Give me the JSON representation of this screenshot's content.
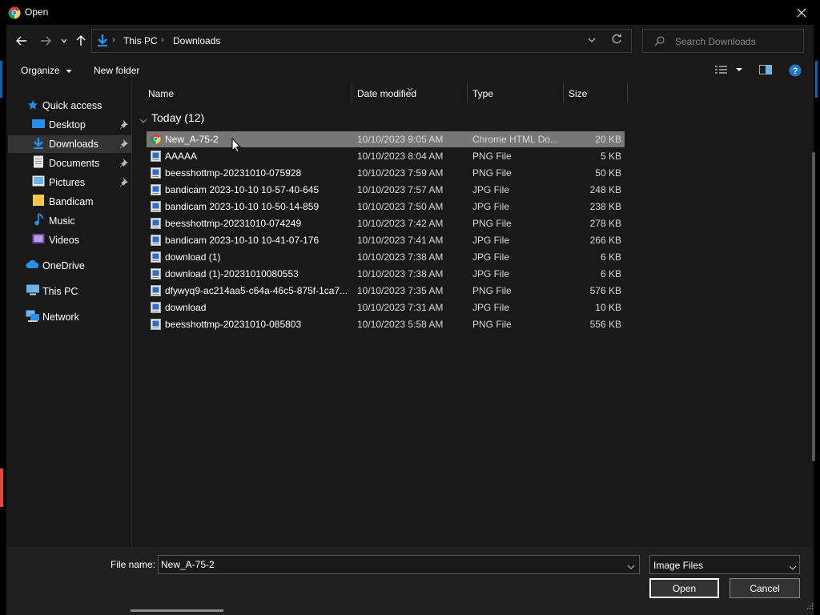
{
  "window": {
    "title": "Open"
  },
  "address": {
    "crumbs": [
      "This PC",
      "Downloads"
    ]
  },
  "search": {
    "placeholder": "Search Downloads"
  },
  "toolbar": {
    "organize_label": "Organize",
    "new_folder_label": "New folder"
  },
  "nav": {
    "items": [
      {
        "label": "Quick access",
        "icon": "star-icon"
      },
      {
        "label": "Desktop",
        "icon": "desktop-icon",
        "pinned": true
      },
      {
        "label": "Downloads",
        "icon": "download-arrow-icon",
        "pinned": true,
        "selected": true
      },
      {
        "label": "Documents",
        "icon": "document-icon",
        "pinned": true
      },
      {
        "label": "Pictures",
        "icon": "pictures-icon",
        "pinned": true
      },
      {
        "label": "Bandicam",
        "icon": "folder-icon"
      },
      {
        "label": "Music",
        "icon": "music-note-icon"
      },
      {
        "label": "Videos",
        "icon": "video-icon"
      },
      {
        "label": "OneDrive",
        "icon": "cloud-icon"
      },
      {
        "label": "This PC",
        "icon": "computer-icon"
      },
      {
        "label": "Network",
        "icon": "network-icon"
      }
    ]
  },
  "columns": {
    "name": "Name",
    "date": "Date modified",
    "type": "Type",
    "size": "Size"
  },
  "group": {
    "label": "Today (12)"
  },
  "files": [
    {
      "name": "New_A-75-2",
      "date": "10/10/2023 9:05 AM",
      "type": "Chrome HTML Do...",
      "size": "20 KB",
      "icon": "chrome-icon",
      "selected": true
    },
    {
      "name": "AAAAA",
      "date": "10/10/2023 8:04 AM",
      "type": "PNG File",
      "size": "5 KB",
      "icon": "image-file-icon"
    },
    {
      "name": "beesshottmp-20231010-075928",
      "date": "10/10/2023 7:59 AM",
      "type": "PNG File",
      "size": "50 KB",
      "icon": "image-file-icon"
    },
    {
      "name": "bandicam 2023-10-10 10-57-40-645",
      "date": "10/10/2023 7:57 AM",
      "type": "JPG File",
      "size": "248 KB",
      "icon": "image-file-icon"
    },
    {
      "name": "bandicam 2023-10-10 10-50-14-859",
      "date": "10/10/2023 7:50 AM",
      "type": "JPG File",
      "size": "238 KB",
      "icon": "image-file-icon"
    },
    {
      "name": "beesshottmp-20231010-074249",
      "date": "10/10/2023 7:42 AM",
      "type": "PNG File",
      "size": "278 KB",
      "icon": "image-file-icon"
    },
    {
      "name": "bandicam 2023-10-10 10-41-07-176",
      "date": "10/10/2023 7:41 AM",
      "type": "JPG File",
      "size": "266 KB",
      "icon": "image-file-icon"
    },
    {
      "name": "download (1)",
      "date": "10/10/2023 7:38 AM",
      "type": "JPG File",
      "size": "6 KB",
      "icon": "image-file-icon"
    },
    {
      "name": "download (1)-20231010080553",
      "date": "10/10/2023 7:38 AM",
      "type": "JPG File",
      "size": "6 KB",
      "icon": "image-file-icon"
    },
    {
      "name": "dfywyq9-ac214aa5-c64a-46c5-875f-1ca7...",
      "date": "10/10/2023 7:35 AM",
      "type": "PNG File",
      "size": "576 KB",
      "icon": "image-file-icon"
    },
    {
      "name": "download",
      "date": "10/10/2023 7:31 AM",
      "type": "JPG File",
      "size": "10 KB",
      "icon": "image-file-icon"
    },
    {
      "name": "beesshottmp-20231010-085803",
      "date": "10/10/2023 5:58 AM",
      "type": "PNG File",
      "size": "556 KB",
      "icon": "image-file-icon"
    }
  ],
  "footer": {
    "filename_label": "File name:",
    "filename_value": "New_A-75-2",
    "filter_value": "Image Files",
    "open_label": "Open",
    "cancel_label": "Cancel"
  },
  "colors": {
    "background": "#191919",
    "selection": "#777777",
    "accent": "#0a64b4",
    "help": "#1e78d2"
  }
}
